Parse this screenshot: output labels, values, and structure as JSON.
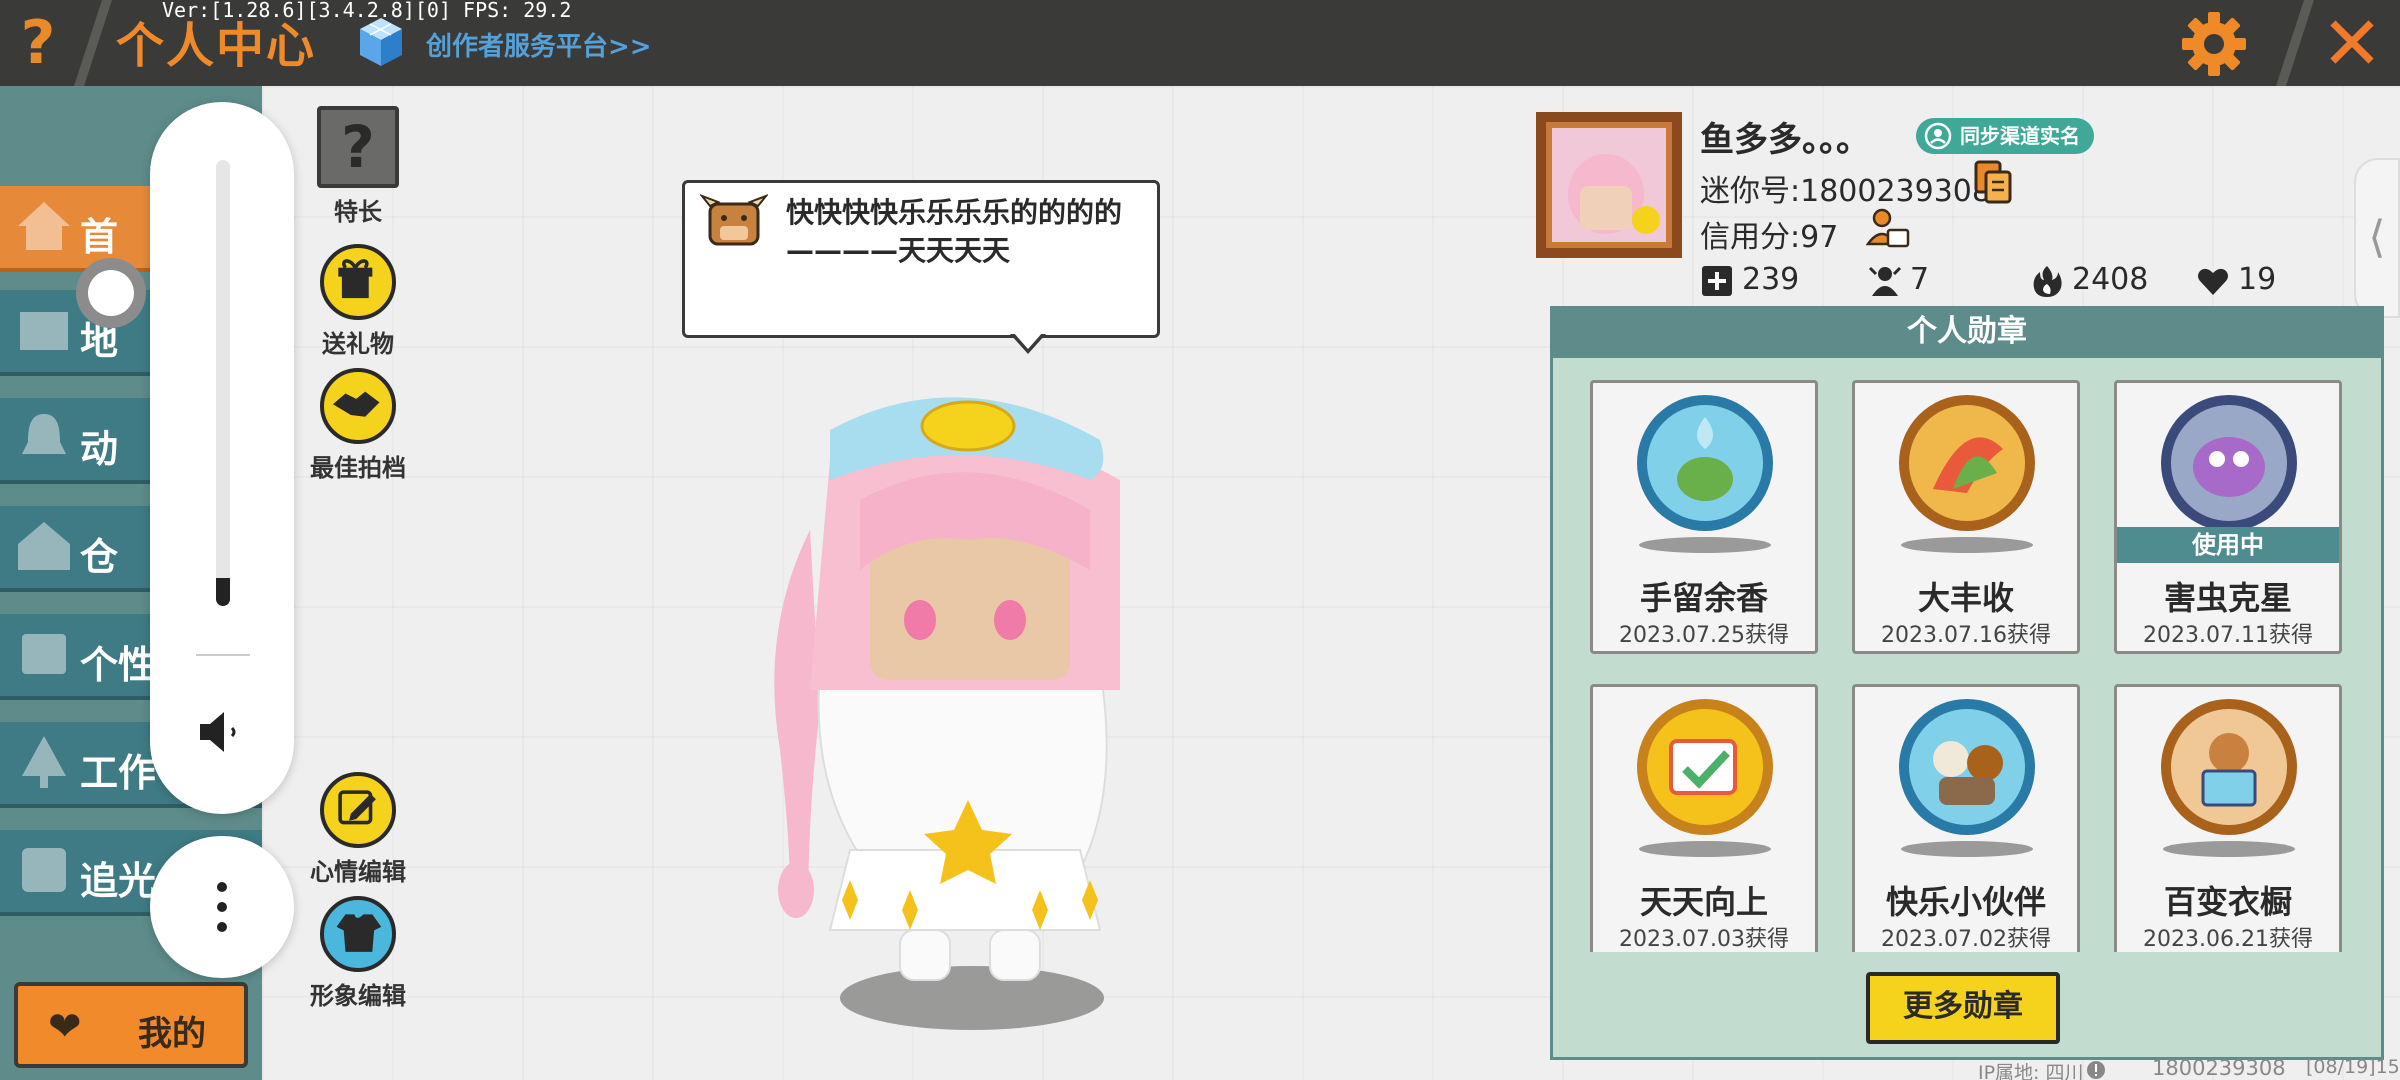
{
  "topbar": {
    "help_label": "?",
    "version": "Ver:[1.28.6][3.4.2.8][0] FPS: 29.2",
    "title": "个人中心",
    "creator_link": "创作者服务平台>>",
    "close_label": "✕",
    "icons": {
      "settings": "gear-icon",
      "creator": "cube-icon"
    },
    "accent_color": "#f08a28"
  },
  "sidebar": {
    "items": [
      {
        "label": "首",
        "active": true
      },
      {
        "label": "地",
        "active": false
      },
      {
        "label": "动",
        "active": false
      },
      {
        "label": "仓",
        "active": false
      },
      {
        "label": "个性",
        "active": false
      },
      {
        "label": "工作",
        "active": false
      },
      {
        "label": "追光",
        "active": false
      }
    ],
    "mine_label": "我的"
  },
  "actions": {
    "skill": {
      "icon_label": "?",
      "label": "特长"
    },
    "gift": {
      "label": "送礼物"
    },
    "photo": {
      "label": "最佳拍档"
    },
    "mood": {
      "label": "心情编辑"
    },
    "outfit": {
      "label": "形象编辑"
    }
  },
  "bubble": {
    "text": "快快快快乐乐乐乐的的的的————天天天天"
  },
  "profile": {
    "nickname": "鱼多多。。。",
    "verify_label": "同步渠道实名",
    "mini_id": "迷你号:1800239308",
    "credit": "信用分:97",
    "stats": {
      "posts": "239",
      "fans": "7",
      "heat": "2408",
      "likes": "19"
    }
  },
  "medals": {
    "title": "个人勋章",
    "items": [
      {
        "name": "手留余香",
        "date": "2023.07.25获得",
        "in_use": false,
        "color": "#5bc0d8"
      },
      {
        "name": "大丰收",
        "date": "2023.07.16获得",
        "in_use": false,
        "color": "#e8a23a"
      },
      {
        "name": "害虫克星",
        "date": "2023.07.11获得",
        "in_use": true,
        "in_use_label": "使用中",
        "color": "#7a6aa8"
      },
      {
        "name": "天天向上",
        "date": "2023.07.03获得",
        "in_use": false,
        "color": "#f0b21c"
      },
      {
        "name": "快乐小伙伴",
        "date": "2023.07.02获得",
        "in_use": false,
        "color": "#5bc0d8"
      },
      {
        "name": "百变衣橱",
        "date": "2023.06.21获得",
        "in_use": false,
        "color": "#e8a23a"
      }
    ],
    "more_label": "更多勋章"
  },
  "footer": {
    "ip": "IP属地: 四川",
    "id": "1800239308",
    "date": "[08/19]15"
  }
}
